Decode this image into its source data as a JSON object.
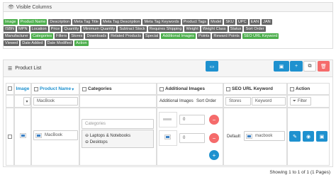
{
  "visible_columns": {
    "title": "Visible Columns",
    "rows": [
      [
        {
          "label": "Image",
          "on": true
        },
        {
          "label": "Product Name",
          "on": true
        },
        {
          "label": "Description",
          "on": false
        },
        {
          "label": "Meta Tag Title",
          "on": false
        },
        {
          "label": "Meta Tag Description",
          "on": false
        },
        {
          "label": "Meta Tag Keywords",
          "on": false
        },
        {
          "label": "Product Tags",
          "on": false
        },
        {
          "label": "Model",
          "on": false
        },
        {
          "label": "SKU",
          "on": false
        },
        {
          "label": "UPC",
          "on": false
        },
        {
          "label": "EAN",
          "on": false
        },
        {
          "label": "JAN",
          "on": false
        }
      ],
      [
        {
          "label": "ISBN",
          "on": false
        },
        {
          "label": "MPN",
          "on": false
        },
        {
          "label": "Location",
          "on": false
        },
        {
          "label": "Price",
          "on": false
        },
        {
          "label": "Quantity",
          "on": false
        },
        {
          "label": "Minimum Quantity",
          "on": false
        },
        {
          "label": "Subtract Stock",
          "on": false
        },
        {
          "label": "Requires Shipping",
          "on": false
        },
        {
          "label": "Weight",
          "on": false
        },
        {
          "label": "Weight Class",
          "on": false
        },
        {
          "label": "Status",
          "on": false
        },
        {
          "label": "Sort Order",
          "on": false
        }
      ],
      [
        {
          "label": "Manufacturer",
          "on": false
        },
        {
          "label": "Categories",
          "on": true
        },
        {
          "label": "Filters",
          "on": false
        },
        {
          "label": "Stores",
          "on": false
        },
        {
          "label": "Downloads",
          "on": false
        },
        {
          "label": "Related Products",
          "on": false
        },
        {
          "label": "Special",
          "on": false
        },
        {
          "label": "Additional Images",
          "on": true
        },
        {
          "label": "Points",
          "on": false
        },
        {
          "label": "Reward Points",
          "on": false
        },
        {
          "label": "SEO URL Keyword",
          "on": true
        }
      ],
      [
        {
          "label": "Viewed",
          "on": false
        },
        {
          "label": "Date Added",
          "on": false
        },
        {
          "label": "Date Modified",
          "on": false
        },
        {
          "label": "Action",
          "on": true
        }
      ]
    ]
  },
  "product_list": {
    "title": "Product List",
    "columns": {
      "image": "Image",
      "product_name": "Product Name",
      "categories": "Categories",
      "additional_images": "Additional Images",
      "seo_url_keyword": "SEO URL Keyword",
      "action": "Action"
    },
    "filters": {
      "product_name_value": "MacBook",
      "additional_images_label": "Additional Images",
      "sort_order_label": "Sort Order",
      "stores_label": "Stores",
      "keyword_label": "Keyword",
      "filter_button": "Filter"
    },
    "row": {
      "product_name": "MacBook",
      "categories_placeholder": "Categories",
      "categories": [
        "Laptops & Notebooks",
        "Desktops"
      ],
      "image_sort_1": "0",
      "image_sort_2": "0",
      "seo_store": "Default",
      "seo_keyword": "macbook"
    },
    "pagination_text": "Showing 1 to 1 of 1 (1 Pages)"
  },
  "colors": {
    "tag_on": "#4cae4c",
    "tag_off": "#666666",
    "primary": "#1e91cf",
    "danger": "#f56b6b"
  }
}
